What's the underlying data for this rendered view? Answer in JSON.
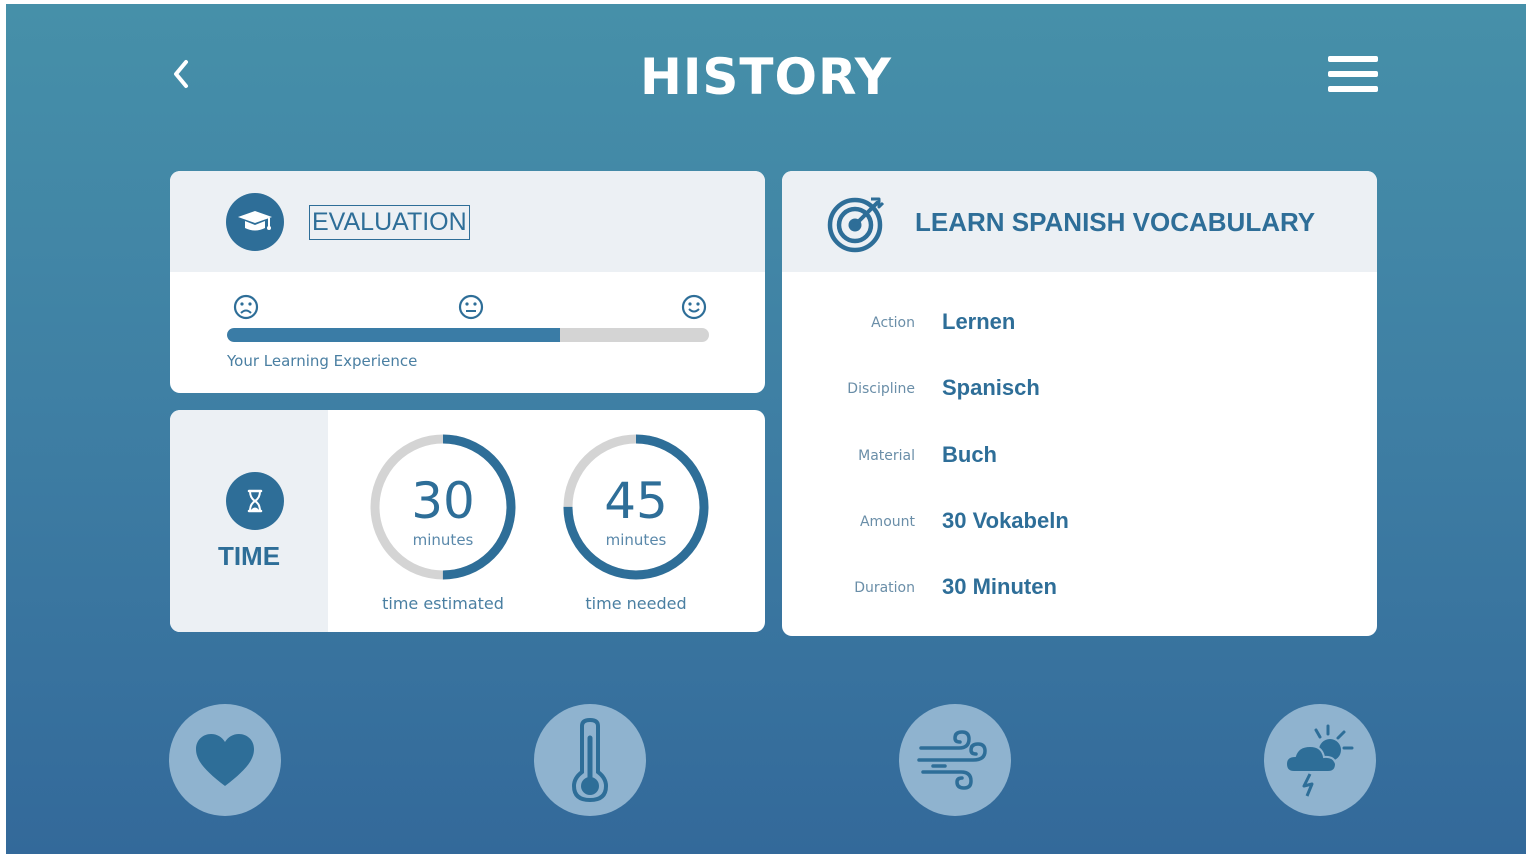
{
  "header": {
    "title": "HISTORY"
  },
  "evaluation": {
    "title": "EVALUATION",
    "label": "Your Learning Experience",
    "progress": 0.69
  },
  "time": {
    "title": "TIME",
    "estimated": {
      "value": "30",
      "unit": "minutes",
      "caption": "time estimated",
      "fraction": 0.5
    },
    "needed": {
      "value": "45",
      "unit": "minutes",
      "caption": "time needed",
      "fraction": 0.75
    }
  },
  "task": {
    "title": "LEARN SPANISH VOCABULARY",
    "rows": [
      {
        "key": "Action",
        "value": "Lernen"
      },
      {
        "key": "Discipline",
        "value": "Spanisch"
      },
      {
        "key": "Material",
        "value": "Buch"
      },
      {
        "key": "Amount",
        "value": "30 Vokabeln"
      },
      {
        "key": "Duration",
        "value": "30 Minuten"
      }
    ]
  },
  "bottom_nav": [
    "heart-icon",
    "thermometer-icon",
    "wind-icon",
    "weather-storm-icon"
  ],
  "colors": {
    "accent": "#2e6e98",
    "bg_top": "#4690a9",
    "bg_bottom": "#33699a",
    "button": "#8fb3cf"
  }
}
